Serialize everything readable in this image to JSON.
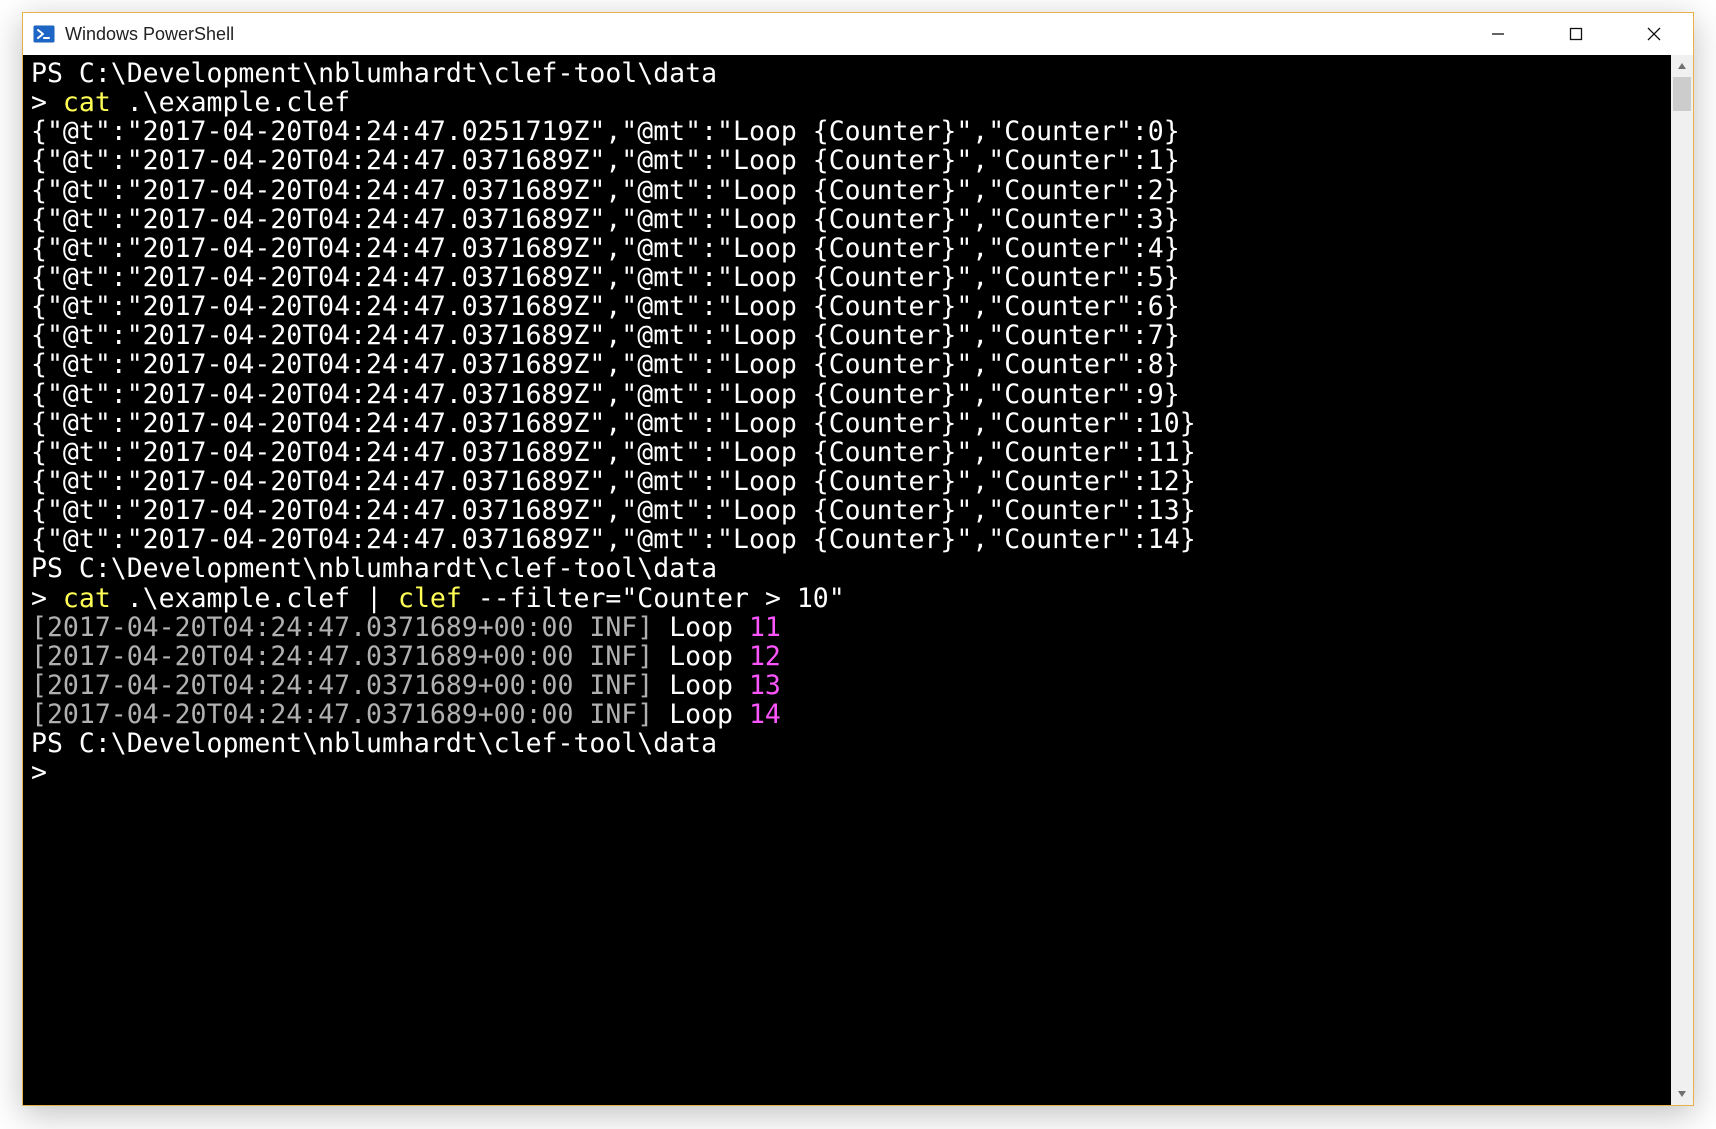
{
  "window": {
    "title": "Windows PowerShell"
  },
  "terminal": {
    "prompt_path": "PS C:\\Development\\nblumhardt\\clef-tool\\data",
    "prompt_symbol": ">",
    "cmd1_cat": "cat",
    "cmd1_arg": " .\\example.clef",
    "json_lines": [
      "{\"@t\":\"2017-04-20T04:24:47.0251719Z\",\"@mt\":\"Loop {Counter}\",\"Counter\":0}",
      "{\"@t\":\"2017-04-20T04:24:47.0371689Z\",\"@mt\":\"Loop {Counter}\",\"Counter\":1}",
      "{\"@t\":\"2017-04-20T04:24:47.0371689Z\",\"@mt\":\"Loop {Counter}\",\"Counter\":2}",
      "{\"@t\":\"2017-04-20T04:24:47.0371689Z\",\"@mt\":\"Loop {Counter}\",\"Counter\":3}",
      "{\"@t\":\"2017-04-20T04:24:47.0371689Z\",\"@mt\":\"Loop {Counter}\",\"Counter\":4}",
      "{\"@t\":\"2017-04-20T04:24:47.0371689Z\",\"@mt\":\"Loop {Counter}\",\"Counter\":5}",
      "{\"@t\":\"2017-04-20T04:24:47.0371689Z\",\"@mt\":\"Loop {Counter}\",\"Counter\":6}",
      "{\"@t\":\"2017-04-20T04:24:47.0371689Z\",\"@mt\":\"Loop {Counter}\",\"Counter\":7}",
      "{\"@t\":\"2017-04-20T04:24:47.0371689Z\",\"@mt\":\"Loop {Counter}\",\"Counter\":8}",
      "{\"@t\":\"2017-04-20T04:24:47.0371689Z\",\"@mt\":\"Loop {Counter}\",\"Counter\":9}",
      "{\"@t\":\"2017-04-20T04:24:47.0371689Z\",\"@mt\":\"Loop {Counter}\",\"Counter\":10}",
      "{\"@t\":\"2017-04-20T04:24:47.0371689Z\",\"@mt\":\"Loop {Counter}\",\"Counter\":11}",
      "{\"@t\":\"2017-04-20T04:24:47.0371689Z\",\"@mt\":\"Loop {Counter}\",\"Counter\":12}",
      "{\"@t\":\"2017-04-20T04:24:47.0371689Z\",\"@mt\":\"Loop {Counter}\",\"Counter\":13}",
      "{\"@t\":\"2017-04-20T04:24:47.0371689Z\",\"@mt\":\"Loop {Counter}\",\"Counter\":14}"
    ],
    "cmd2_cat": "cat",
    "cmd2_arg": " .\\example.clef | ",
    "cmd2_clef": "clef",
    "cmd2_tail": " --filter=\"Counter > 10\"",
    "filtered": [
      {
        "ts": "[2017-04-20T04:24:47.0371689+00:00 INF]",
        "msg": " Loop ",
        "num": "11"
      },
      {
        "ts": "[2017-04-20T04:24:47.0371689+00:00 INF]",
        "msg": " Loop ",
        "num": "12"
      },
      {
        "ts": "[2017-04-20T04:24:47.0371689+00:00 INF]",
        "msg": " Loop ",
        "num": "13"
      },
      {
        "ts": "[2017-04-20T04:24:47.0371689+00:00 INF]",
        "msg": " Loop ",
        "num": "14"
      }
    ]
  }
}
